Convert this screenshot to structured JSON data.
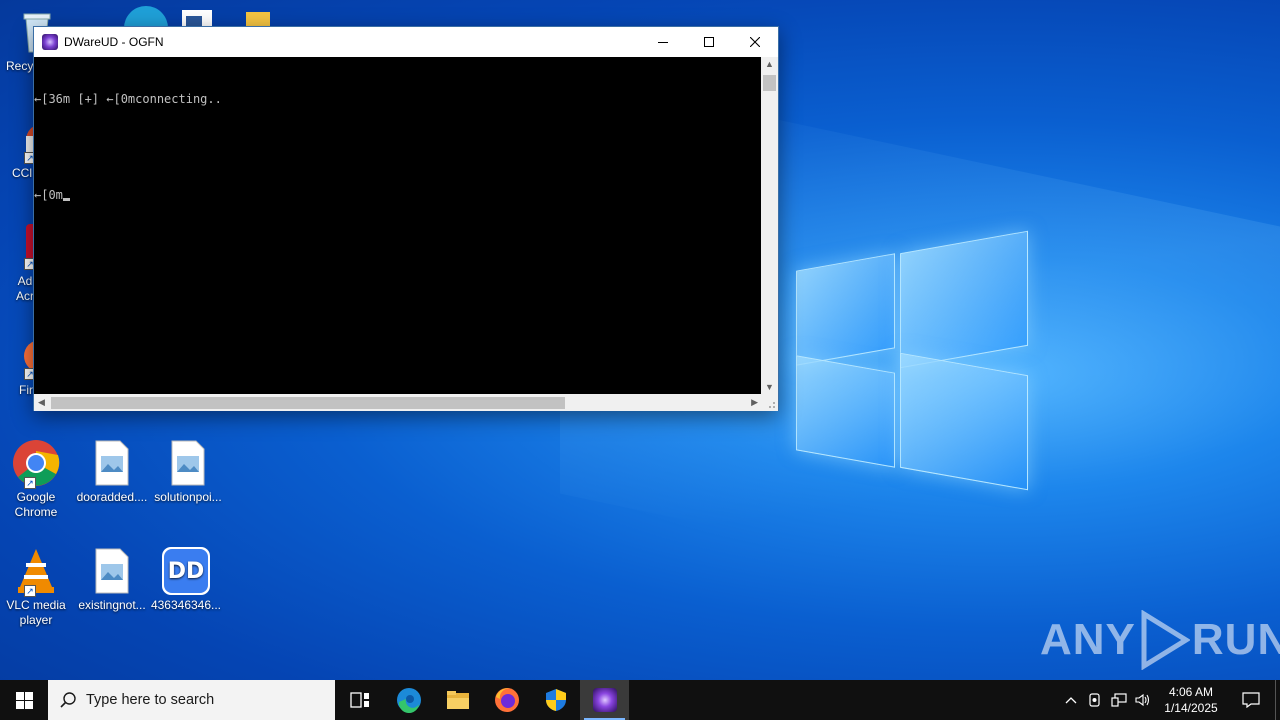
{
  "desktop": {
    "icons": [
      {
        "label": "Recy",
        "icon": "recycle-bin-icon"
      },
      {
        "label": "CCl",
        "icon": "ccleaner-icon"
      },
      {
        "label": "Ad\nAcr",
        "icon": "adobe-acrobat-icon"
      },
      {
        "label": "Fir",
        "icon": "firefox-icon"
      },
      {
        "label": "Google Chrome",
        "icon": "chrome-icon"
      },
      {
        "label": "dooradded....",
        "icon": "image-file-icon"
      },
      {
        "label": "solutionpoi...",
        "icon": "image-file-icon"
      },
      {
        "label": "VLC media player",
        "icon": "vlc-icon"
      },
      {
        "label": "existingnot...",
        "icon": "image-file-icon"
      },
      {
        "label": "436346346...",
        "icon": "dd-app-icon"
      }
    ]
  },
  "console_window": {
    "title": "DWareUD - OGFN",
    "lines": [
      "←[36m [+] ←[0mconnecting..",
      "",
      "←[0m"
    ],
    "horizontal_scroll_fraction": 0.74
  },
  "watermark": {
    "left": "ANY",
    "right": "RUN"
  },
  "taskbar": {
    "search_placeholder": "Type here to search",
    "pinned": [
      "task-view",
      "edge",
      "file-explorer",
      "firefox",
      "security-shield",
      "dware-app"
    ],
    "active": "dware-app",
    "time": "4:06 AM",
    "date": "1/14/2025"
  },
  "colors": {
    "accent": "#0a5fd0",
    "taskbar": "#101010",
    "console_bg": "#000000"
  }
}
